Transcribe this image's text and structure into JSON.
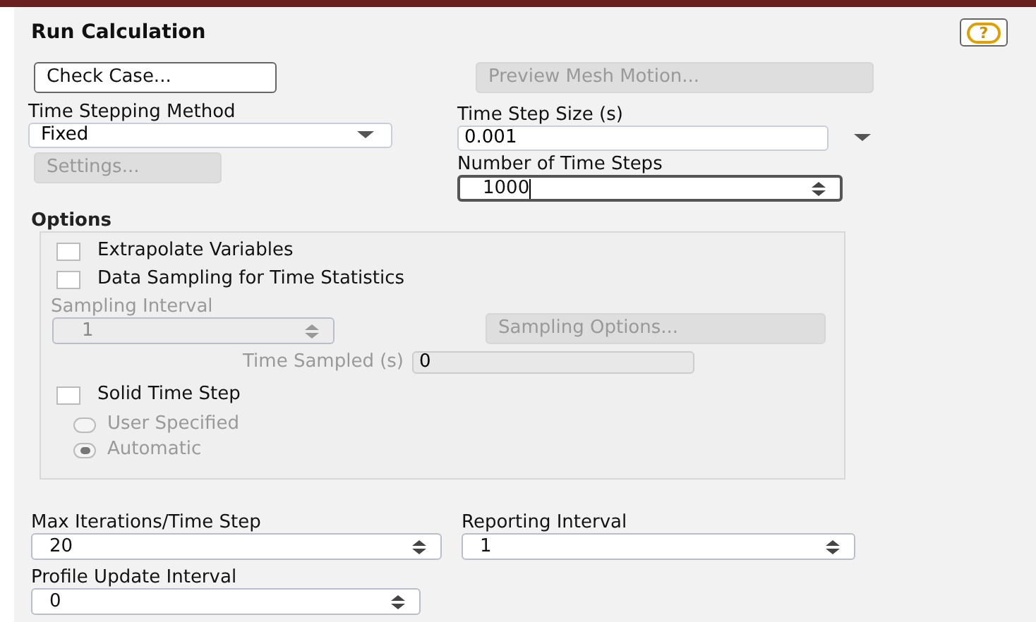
{
  "panel": {
    "title": "Run Calculation",
    "help_label": "?"
  },
  "buttons_top": [
    {
      "label": "Check Case...",
      "disabled": false
    },
    {
      "label": "Preview Mesh Motion...",
      "disabled": true
    }
  ],
  "time_stepping_method": {
    "label": "Time Stepping Method",
    "value": "Fixed"
  },
  "settings_button": {
    "label": "Settings...",
    "disabled": true
  },
  "time_step_size": {
    "label": "Time Step Size (s)",
    "value": "0.001"
  },
  "number_of_time_steps": {
    "label": "Number of Time Steps",
    "value": "1000",
    "focused": true
  },
  "options": {
    "title": "Options",
    "checkboxes": [
      {
        "label": "Extrapolate Variables",
        "checked": false
      },
      {
        "label": "Data Sampling for Time Statistics",
        "checked": false
      }
    ],
    "sampling_interval": {
      "label": "Sampling Interval",
      "value": "1",
      "disabled": true
    },
    "sampling_options_button": {
      "label": "Sampling Options...",
      "disabled": true
    },
    "time_sampled": {
      "label": "Time Sampled (s)",
      "value": "0",
      "disabled": true
    },
    "solid_time_step": {
      "label": "Solid Time Step",
      "checked": false
    },
    "radios": [
      {
        "label": "User Specified",
        "selected": false,
        "disabled": true
      },
      {
        "label": "Automatic",
        "selected": true,
        "disabled": true
      }
    ]
  },
  "max_iterations": {
    "label": "Max Iterations/Time Step",
    "value": "20"
  },
  "reporting_interval": {
    "label": "Reporting Interval",
    "value": "1"
  },
  "profile_update_interval": {
    "label": "Profile Update Interval",
    "value": "0"
  }
}
